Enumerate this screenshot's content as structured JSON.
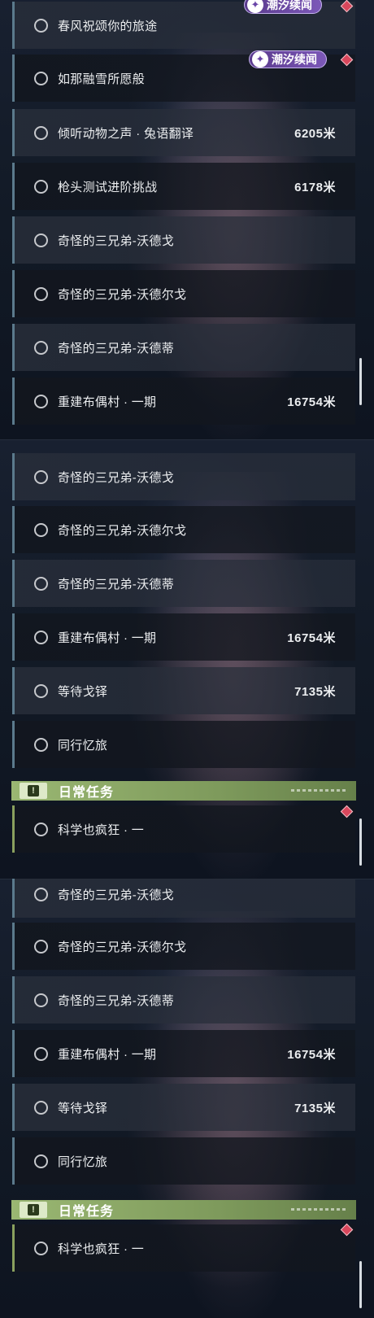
{
  "panels": [
    {
      "rows": [
        {
          "title": "春风祝颂你的旅途",
          "distance": ""
        },
        {
          "title": "如那融雪所愿般",
          "distance": ""
        },
        {
          "title": "倾听动物之声 · 兔语翻译",
          "distance": "6205米"
        },
        {
          "title": "枪头测试进阶挑战",
          "distance": "6178米"
        },
        {
          "title": "奇怪的三兄弟-沃德戈",
          "distance": ""
        },
        {
          "title": "奇怪的三兄弟-沃德尔戈",
          "distance": ""
        },
        {
          "title": "奇怪的三兄弟-沃德蒂",
          "distance": ""
        },
        {
          "title": "重建布偶村 · 一期",
          "distance": "16754米"
        }
      ],
      "tags": [
        "潮汐续闻",
        "潮汐续闻"
      ]
    },
    {
      "rows": [
        {
          "title": "奇怪的三兄弟-沃德戈",
          "distance": ""
        },
        {
          "title": "奇怪的三兄弟-沃德尔戈",
          "distance": ""
        },
        {
          "title": "奇怪的三兄弟-沃德蒂",
          "distance": ""
        },
        {
          "title": "重建布偶村 · 一期",
          "distance": "16754米"
        },
        {
          "title": "等待戈铎",
          "distance": "7135米"
        },
        {
          "title": "同行忆旅",
          "distance": ""
        }
      ],
      "section": {
        "title": "日常任务",
        "icon": "!"
      },
      "daily_rows": [
        {
          "title": "科学也疯狂 · 一",
          "distance": ""
        }
      ]
    },
    {
      "rows": [
        {
          "title": "奇怪的三兄弟-沃德戈",
          "distance": ""
        },
        {
          "title": "奇怪的三兄弟-沃德尔戈",
          "distance": ""
        },
        {
          "title": "奇怪的三兄弟-沃德蒂",
          "distance": ""
        },
        {
          "title": "重建布偶村 · 一期",
          "distance": "16754米"
        },
        {
          "title": "等待戈铎",
          "distance": "7135米"
        },
        {
          "title": "同行忆旅",
          "distance": ""
        }
      ],
      "section": {
        "title": "日常任务",
        "icon": "!"
      },
      "daily_rows": [
        {
          "title": "科学也疯狂 · 一",
          "distance": ""
        }
      ]
    }
  ],
  "icons": {
    "tag_icon": "tide-icon",
    "radio": "radio-circle-icon",
    "marker": "diamond-marker-icon",
    "section": "exclamation-icon"
  },
  "colors": {
    "row_accent": "#5b7a8c",
    "daily_accent": "#8aa05e",
    "tag_purple": "#7c58b8",
    "marker_red": "#d9475c"
  }
}
